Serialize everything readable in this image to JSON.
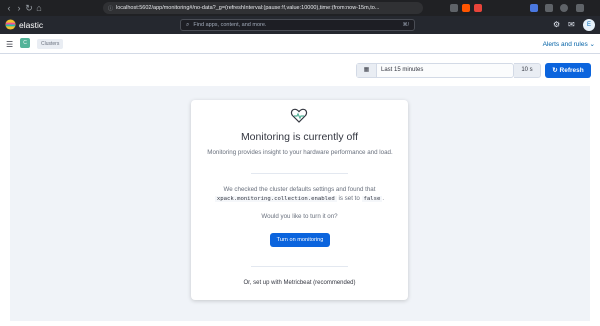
{
  "browser": {
    "url": "localhost:5602/app/monitoring#/no-data?_g=(refreshInterval:(pause:!f,value:10000),time:(from:now-15m,to..."
  },
  "header": {
    "logo_text": "elastic",
    "search_placeholder": "Find apps, content, and more.",
    "search_shortcut": "⌘/",
    "avatar_initial": "E"
  },
  "subbar": {
    "app_badge": "C",
    "breadcrumb": "Clusters",
    "alerts_label": "Alerts and rules"
  },
  "toolbar": {
    "date_range": "Last 15 minutes",
    "interval": "10 s",
    "refresh_label": "Refresh"
  },
  "card": {
    "title": "Monitoring is currently off",
    "description": "Monitoring provides insight to your hardware performance and load.",
    "check_text_before": "We checked the cluster defaults settings and found that",
    "setting_name": "xpack.monitoring.collection.enabled",
    "check_text_mid": "is set to",
    "setting_value": "false",
    "check_text_end": ".",
    "question": "Would you like to turn it on?",
    "turn_on_label": "Turn on monitoring",
    "metricbeat_link": "Or, set up with Metricbeat (recommended)"
  },
  "colors": {
    "accent": "#0b64dd",
    "header_bg": "#25282f",
    "page_bg": "#f0f3f8"
  }
}
